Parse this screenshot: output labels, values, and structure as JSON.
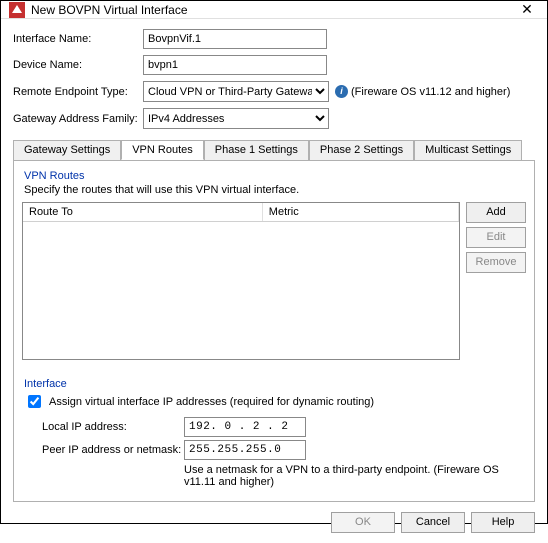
{
  "titlebar": {
    "title": "New BOVPN Virtual Interface"
  },
  "form": {
    "interface_name_label": "Interface Name:",
    "interface_name_value": "BovpnVif.1",
    "device_name_label": "Device Name:",
    "device_name_value": "bvpn1",
    "remote_endpoint_label": "Remote Endpoint Type:",
    "remote_endpoint_value": "Cloud VPN or Third-Party Gateway",
    "remote_endpoint_note": "(Fireware OS v11.12 and higher)",
    "gateway_family_label": "Gateway Address Family:",
    "gateway_family_value": "IPv4 Addresses"
  },
  "tabs": {
    "gateway": "Gateway Settings",
    "vpn": "VPN Routes",
    "phase1": "Phase 1 Settings",
    "phase2": "Phase 2 Settings",
    "multicast": "Multicast Settings"
  },
  "vpn_panel": {
    "group_title": "VPN Routes",
    "desc": "Specify the routes that will use this VPN virtual interface.",
    "col_route": "Route To",
    "col_metric": "Metric",
    "btn_add": "Add",
    "btn_edit": "Edit",
    "btn_remove": "Remove"
  },
  "iface_panel": {
    "group_title": "Interface",
    "chk_label": "Assign virtual interface IP addresses (required for dynamic routing)",
    "local_ip_label": "Local IP address:",
    "local_ip_value": "192. 0 . 2 . 2",
    "peer_ip_label": "Peer IP address or netmask:",
    "peer_ip_value": "255.255.255.0",
    "peer_note": "Use a netmask for a VPN to a third-party endpoint. (Fireware OS v11.11 and higher)"
  },
  "footer": {
    "ok": "OK",
    "cancel": "Cancel",
    "help": "Help"
  }
}
